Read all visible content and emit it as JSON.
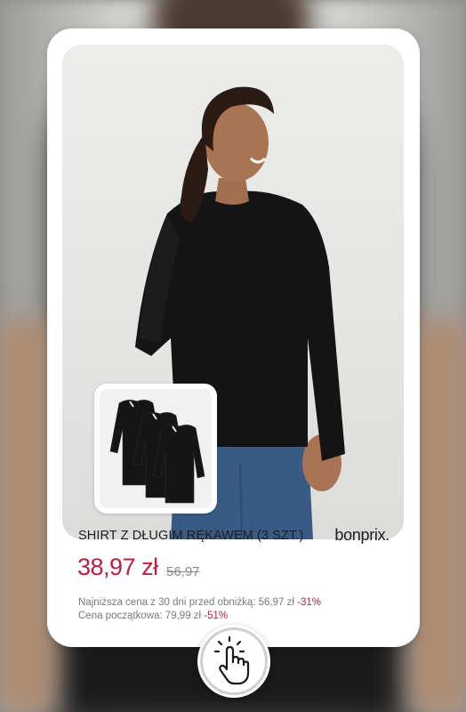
{
  "product": {
    "title": "SHIRT Z DŁUGIM RĘKAWEM (3 SZT.)",
    "brand": "bonprix.",
    "price": "38,97 zł",
    "old_price": "56,97",
    "lowest_price_label": "Najniższa cena z 30 dni  przed obniżką: 56,97 zł",
    "lowest_price_discount": "-31%",
    "initial_price_label": "Cena początkowa: 79,99 zł",
    "initial_price_discount": "-51%"
  },
  "colors": {
    "price": "#b8213f",
    "shirt": "#141414",
    "jeans": "#3a5a86"
  },
  "icons": {
    "tap": "hand-pointer-tap-icon"
  }
}
